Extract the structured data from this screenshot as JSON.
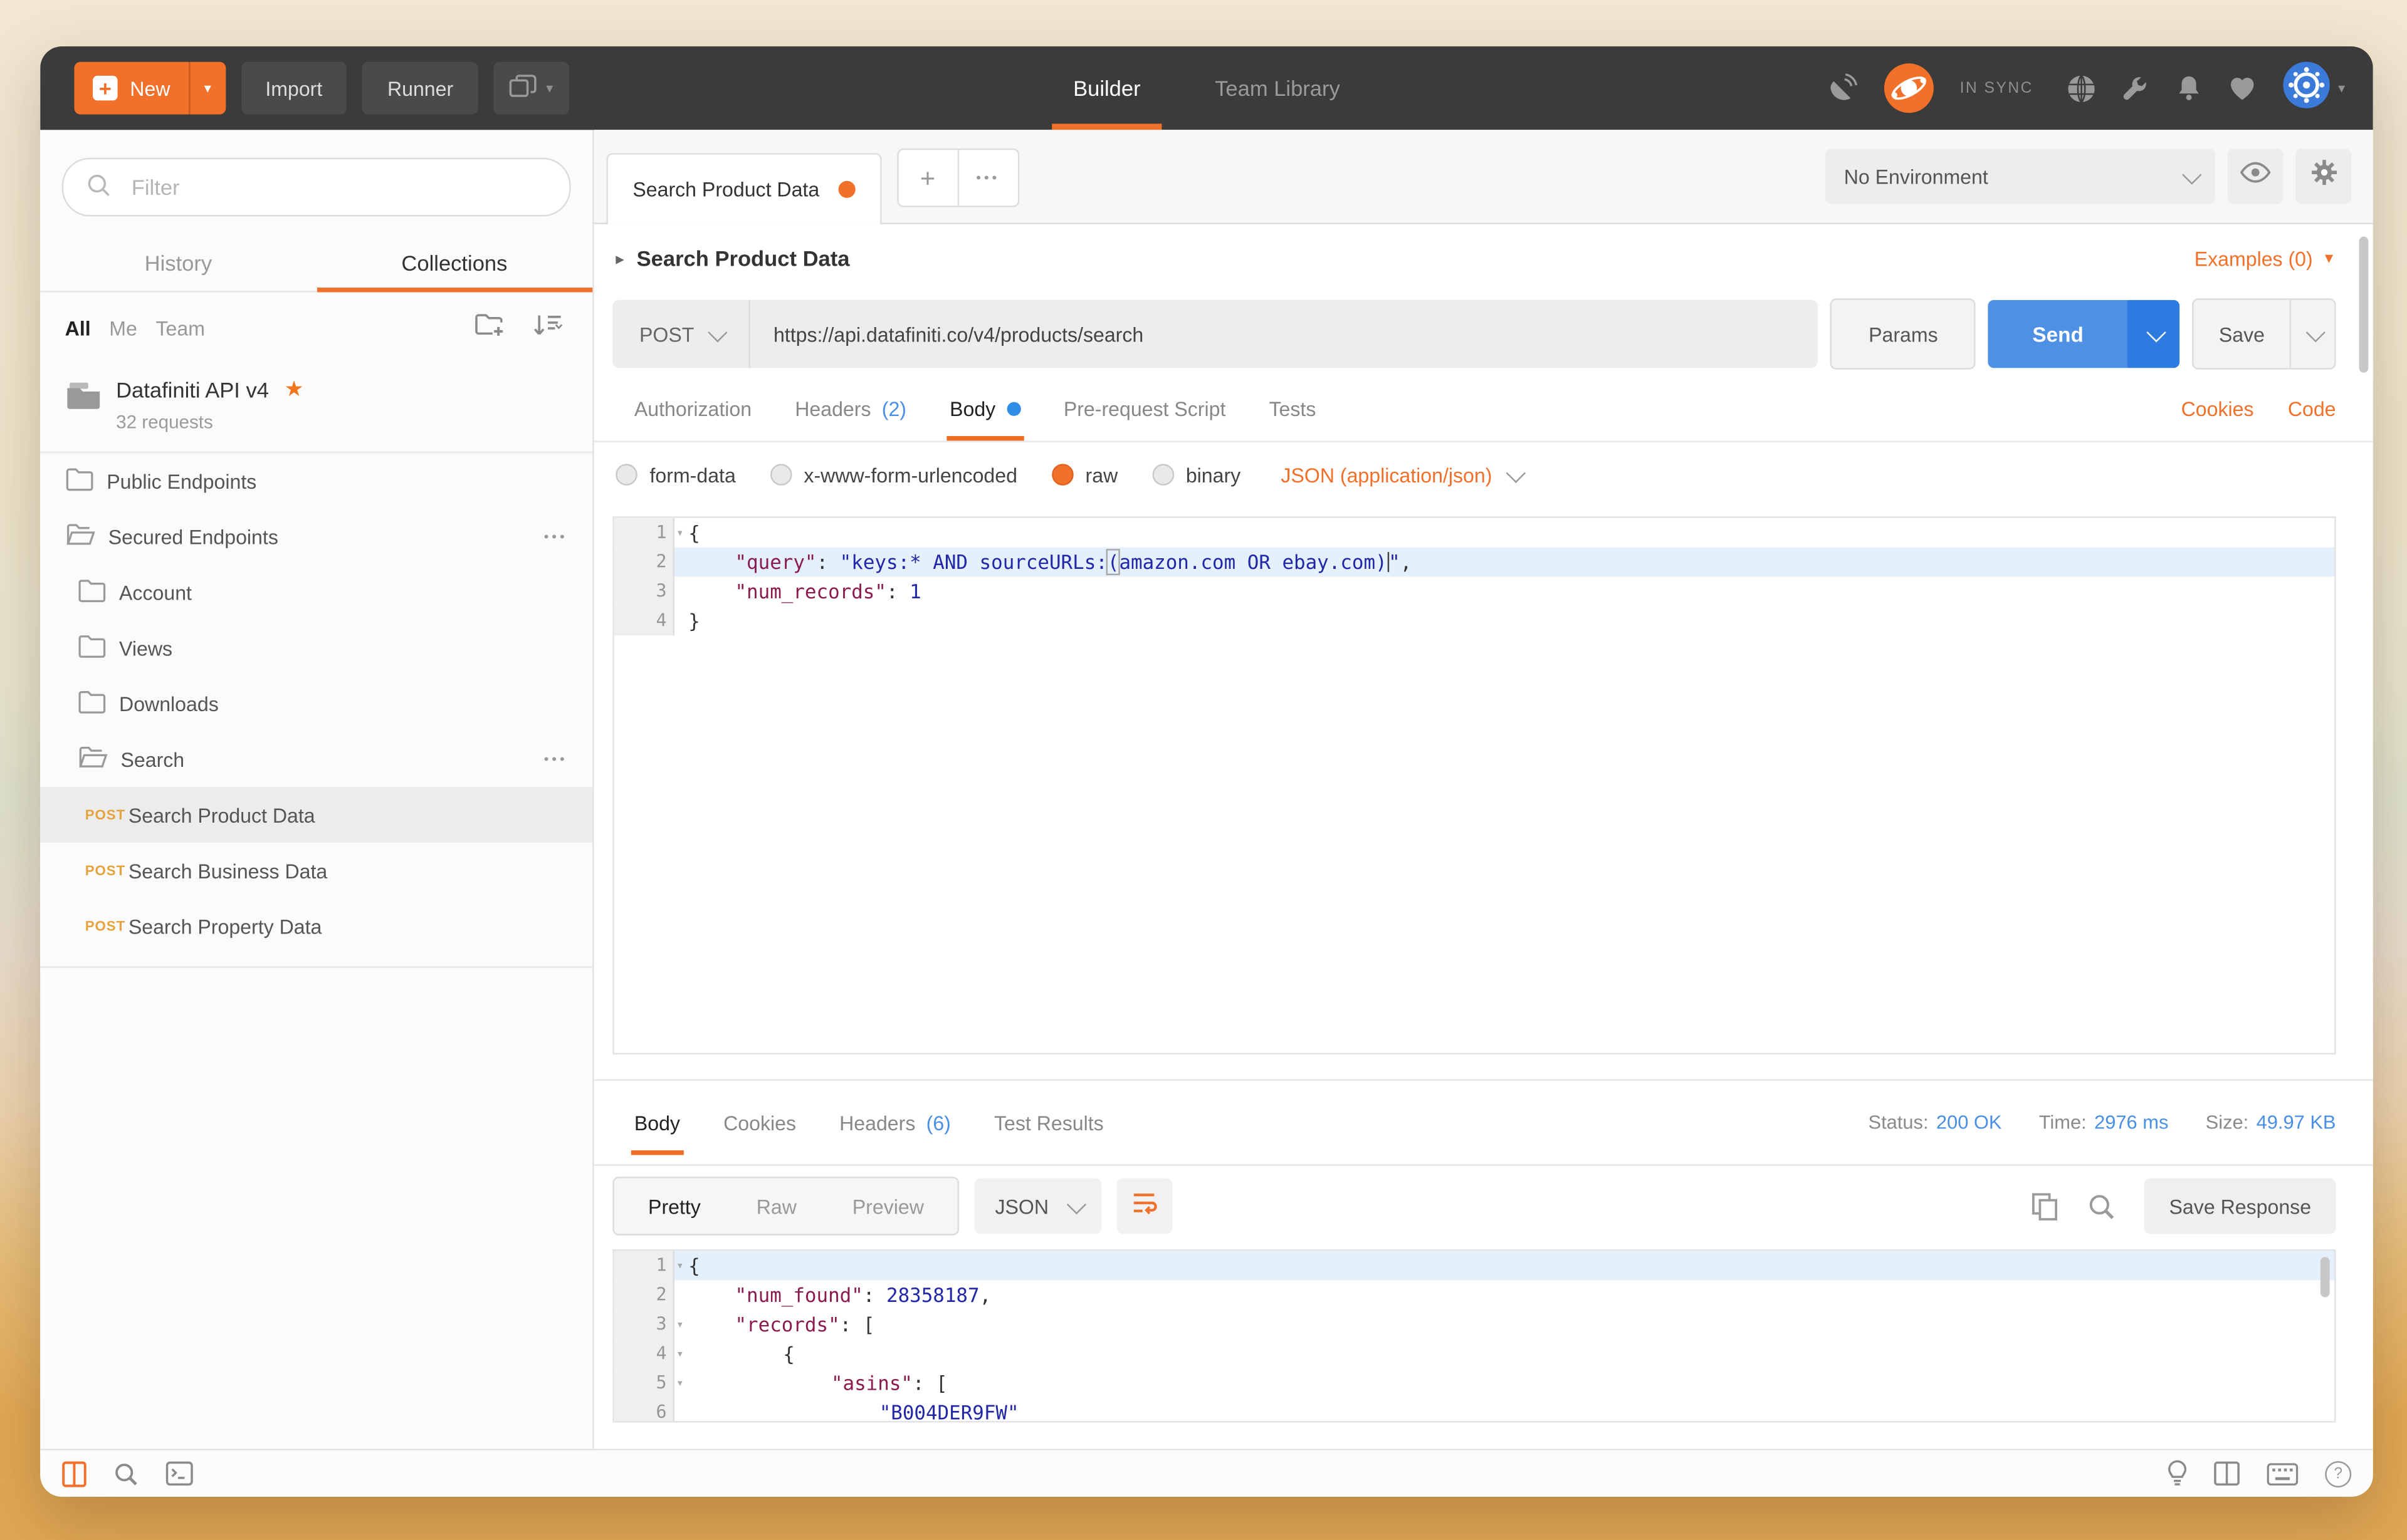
{
  "header": {
    "new_label": "New",
    "import_label": "Import",
    "runner_label": "Runner",
    "tabs": {
      "builder": "Builder",
      "team_library": "Team Library"
    },
    "sync_status": "IN SYNC"
  },
  "sidebar": {
    "filter_placeholder": "Filter",
    "tabs": {
      "history": "History",
      "collections": "Collections"
    },
    "scope": {
      "all": "All",
      "me": "Me",
      "team": "Team"
    },
    "collection": {
      "name": "Datafiniti API v4",
      "meta": "32 requests",
      "star": "★"
    },
    "folders": [
      {
        "name": "Public Endpoints",
        "level": 1
      },
      {
        "name": "Secured Endpoints",
        "level": 1,
        "menu": "•••"
      },
      {
        "name": "Account",
        "level": 2
      },
      {
        "name": "Views",
        "level": 2
      },
      {
        "name": "Downloads",
        "level": 2
      },
      {
        "name": "Search",
        "level": 2,
        "menu": "•••"
      }
    ],
    "requests": [
      {
        "method": "POST",
        "name": "Search Product Data",
        "selected": true
      },
      {
        "method": "POST",
        "name": "Search Business Data"
      },
      {
        "method": "POST",
        "name": "Search Property Data"
      }
    ]
  },
  "workspace": {
    "tab_title": "Search Product Data",
    "environment": "No Environment"
  },
  "request": {
    "title": "Search Product Data",
    "examples_label": "Examples (0)",
    "method": "POST",
    "url": "https://api.datafiniti.co/v4/products/search",
    "params_label": "Params",
    "send_label": "Send",
    "save_label": "Save",
    "tabs": {
      "authorization": "Authorization",
      "headers": "Headers",
      "headers_count": "(2)",
      "body": "Body",
      "pre_request": "Pre-request Script",
      "tests": "Tests"
    },
    "links": {
      "cookies": "Cookies",
      "code": "Code"
    },
    "body_modes": {
      "form_data": "form-data",
      "urlencoded": "x-www-form-urlencoded",
      "raw": "raw",
      "binary": "binary"
    },
    "content_type": "JSON (application/json)"
  },
  "request_editor": {
    "lines": [
      {
        "num": "1",
        "text": "{"
      },
      {
        "num": "2",
        "key": "\"query\"",
        "colon": ": ",
        "str_open": "\"keys:* AND sourceURLs:",
        "paren_open": "(",
        "str_mid": "amazon.com OR ebay.com",
        "paren_close": ")",
        "str_close": "\"",
        "comma": ","
      },
      {
        "num": "3",
        "key": "\"num_records\"",
        "colon": ": ",
        "number": "1"
      },
      {
        "num": "4",
        "text": "}"
      }
    ]
  },
  "response": {
    "tabs": {
      "body": "Body",
      "cookies": "Cookies",
      "headers": "Headers",
      "headers_count": "(6)",
      "test_results": "Test Results"
    },
    "status_label": "Status:",
    "status_value": "200 OK",
    "time_label": "Time:",
    "time_value": "2976 ms",
    "size_label": "Size:",
    "size_value": "49.97 KB",
    "views": {
      "pretty": "Pretty",
      "raw": "Raw",
      "preview": "Preview"
    },
    "language": "JSON",
    "save_response_label": "Save Response"
  },
  "response_editor": {
    "lines": [
      {
        "num": "1",
        "text": "{"
      },
      {
        "num": "2",
        "key": "\"num_found\"",
        "colon": ": ",
        "number": "28358187",
        "comma": ","
      },
      {
        "num": "3",
        "key": "\"records\"",
        "colon": ": ",
        "bracket": "["
      },
      {
        "num": "4",
        "text": "{"
      },
      {
        "num": "5",
        "key": "\"asins\"",
        "colon": ": ",
        "bracket": "["
      },
      {
        "num": "6",
        "string": "\"B004DER9FW\""
      }
    ]
  },
  "colors": {
    "accent_orange": "#f1702a",
    "send_blue": "#4e91e4",
    "link_blue": "#4a90e2",
    "post_badge": "#e6a23c"
  }
}
